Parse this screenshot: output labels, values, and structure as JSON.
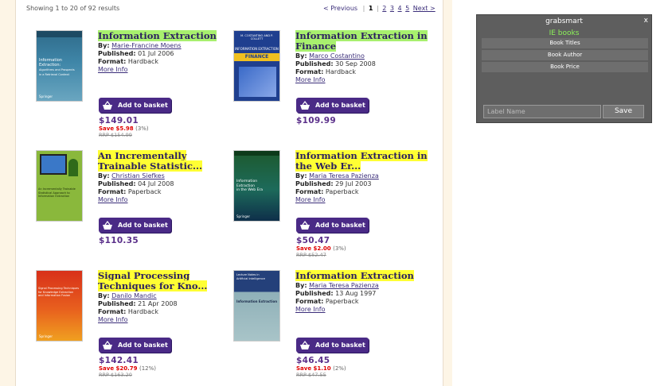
{
  "results": {
    "text": "Showing 1 to 20 of 92 results"
  },
  "pager": {
    "previous": "< Previous",
    "current": "1",
    "pages": [
      "2",
      "3",
      "4",
      "5"
    ],
    "next": "Next >"
  },
  "labels": {
    "by": "By:",
    "published": "Published:",
    "format": "Format:",
    "more_info": "More Info",
    "add_to_basket": "Add to basket"
  },
  "products": [
    {
      "title": "Information Extraction",
      "author": "Marie-Francine Moens",
      "published": "01 Jul 2006",
      "format": "Hardback",
      "price": "$149.01",
      "save": "Save $5.98",
      "save_pct": "(3%)",
      "rrp": "RRP $154.99",
      "highlight": "green"
    },
    {
      "title": "Information Extraction in Finance",
      "author": "Marco Costantino",
      "published": "30 Sep 2008",
      "format": "Hardback",
      "price": "$109.99",
      "save": "",
      "save_pct": "",
      "rrp": "",
      "highlight": "green"
    },
    {
      "title": "An Incrementally Trainable Statistic...",
      "author": "Christian Siefkes",
      "published": "04 Jul 2008",
      "format": "Paperback",
      "price": "$110.35",
      "save": "",
      "save_pct": "",
      "rrp": "",
      "highlight": "yellow"
    },
    {
      "title": "Information Extraction in the Web Er...",
      "author": "Maria Teresa Pazienza",
      "published": "29 Jul 2003",
      "format": "Paperback",
      "price": "$50.47",
      "save": "Save $2.00",
      "save_pct": "(3%)",
      "rrp": "RRP $52.47",
      "highlight": "yellow"
    },
    {
      "title": "Signal Processing Techniques for Kno...",
      "author": "Danilo Mandic",
      "published": "21 Apr 2008",
      "format": "Hardback",
      "price": "$142.41",
      "save": "Save $20.79",
      "save_pct": "(12%)",
      "rrp": "RRP $163.20",
      "highlight": "yellow"
    },
    {
      "title": "Information Extraction",
      "author": "Maria Teresa Pazienza",
      "published": "13 Aug 1997",
      "format": "Paperback",
      "price": "$46.45",
      "save": "Save $1.10",
      "save_pct": "(2%)",
      "rrp": "RRP $47.55",
      "highlight": "yellow"
    }
  ],
  "widget": {
    "title": "grabsmart",
    "close": "x",
    "subtitle": "IE books",
    "rows": [
      "Book Titles",
      "Book Author",
      "Book Price"
    ],
    "input_placeholder": "Label Name",
    "save": "Save"
  },
  "colors": {
    "accent": "#4a2a86",
    "price": "#5a2f8a",
    "save": "#e00000",
    "highlight_green": "#a8f06e",
    "highlight_yellow": "#ffff33"
  },
  "covers": [
    {
      "text": [
        "Information",
        "Extraction:",
        "Algorithms and Prospects",
        "in a Retrieval Context"
      ],
      "publisher": "Springer"
    },
    {
      "text": [
        "M. COSTANTINO AND P. COLLETT",
        "INFORMATION EXTRACTION",
        "FINANCE"
      ],
      "publisher": ""
    },
    {
      "text": [
        "An Incrementally Trainable",
        "Statistical Approach to",
        "Information Extraction"
      ],
      "publisher": ""
    },
    {
      "text": [
        "Information",
        "Extraction",
        "in the Web Era"
      ],
      "publisher": "Springer"
    },
    {
      "text": [
        "Signal Processing Techniques",
        "for Knowledge Extraction",
        "and Information Fusion"
      ],
      "publisher": "Springer"
    },
    {
      "text": [
        "Lecture Notes in",
        "Artificial Intelligence",
        "Information Extraction"
      ],
      "publisher": ""
    }
  ]
}
